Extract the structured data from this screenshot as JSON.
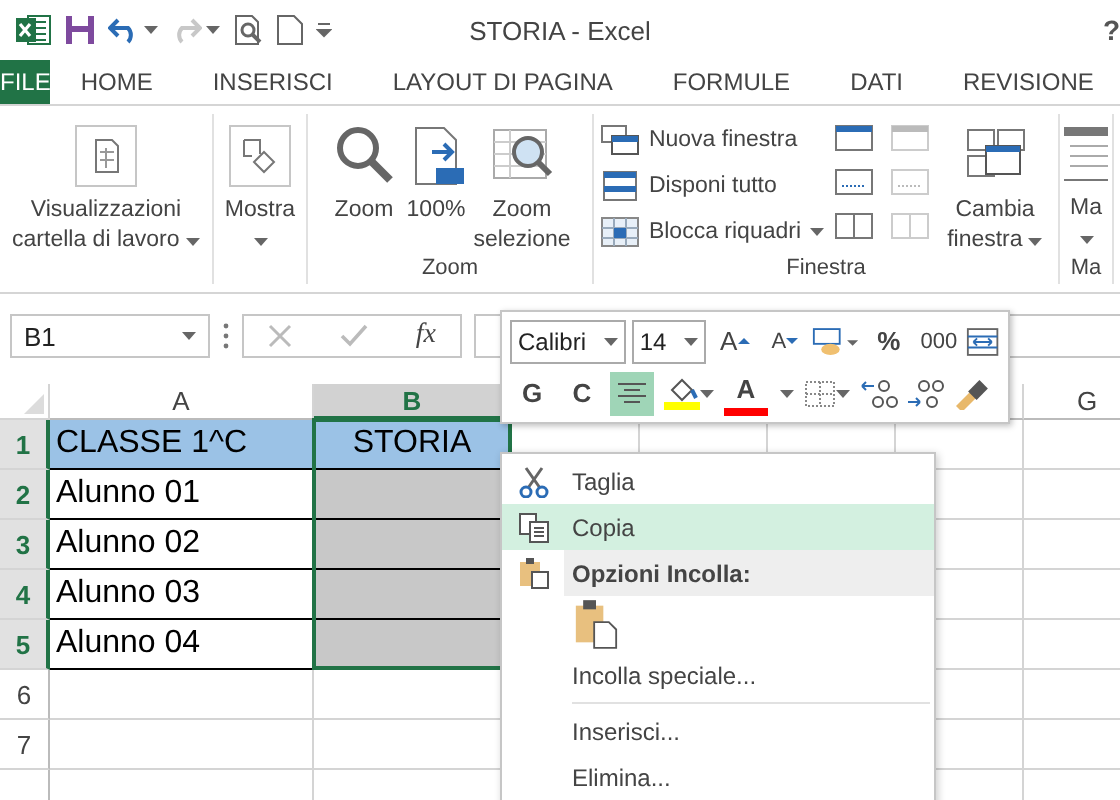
{
  "quick_access": [
    {
      "kind": "undo",
      "disabled": false
    },
    {
      "kind": "redo",
      "disabled": true
    }
  ],
  "window": {
    "title": "STORIA - Excel",
    "help": "?"
  },
  "tabs": [
    {
      "label": "FILE",
      "kind": "file",
      "selected": false
    },
    {
      "label": "HOME",
      "kind": "tab",
      "selected": false
    },
    {
      "label": "INSERISCI",
      "kind": "tab",
      "selected": false
    },
    {
      "label": "LAYOUT DI PAGINA",
      "kind": "tab",
      "selected": false
    },
    {
      "label": "FORMULE",
      "kind": "tab",
      "selected": false
    },
    {
      "label": "DATI",
      "kind": "tab",
      "selected": false
    },
    {
      "label": "REVISIONE",
      "kind": "tab",
      "selected": false
    }
  ],
  "ribbon": {
    "groups": [
      {
        "items": [
          {
            "kind": "large",
            "label": "Visualizzazioni cartella di lavoro",
            "dropdown": true
          }
        ]
      },
      {
        "items": [
          {
            "kind": "large",
            "label": "Mostra",
            "dropdown": true
          }
        ]
      },
      {
        "label": "Zoom",
        "items": [
          {
            "kind": "large",
            "label": "Zoom",
            "dropdown": false
          },
          {
            "kind": "large",
            "label": "100%",
            "dropdown": false
          },
          {
            "kind": "large",
            "label": "Zoom selezione",
            "dropdown": false
          }
        ]
      },
      {
        "label": "Finestra",
        "items": [
          {
            "kind": "stack",
            "buttons": [
              {
                "label": "Nuova finestra",
                "dropdown": false
              },
              {
                "label": "Disponi tutto",
                "dropdown": false
              },
              {
                "label": "Blocca riquadri",
                "dropdown": true
              }
            ]
          },
          {
            "kind": "icons",
            "disabled": false
          },
          {
            "kind": "icons",
            "disabled": true
          },
          {
            "kind": "large",
            "label": "Cambia finestra",
            "dropdown": true
          }
        ]
      },
      {
        "label": "Ma",
        "items": [
          {
            "kind": "large",
            "label": "Ma",
            "dropdown": true
          }
        ]
      }
    ]
  },
  "formula_bar": {
    "name_box": "B1",
    "function_button": "fx"
  },
  "mini_toolbar": {
    "font": "Calibri",
    "size": "14",
    "row_1": [
      {
        "kind": "grow",
        "label": "A"
      },
      {
        "kind": "shrink",
        "label": "A"
      },
      {
        "kind": "accounting"
      },
      {
        "kind": "text",
        "label": "%"
      },
      {
        "kind": "text",
        "label": "000"
      },
      {
        "kind": "merge"
      }
    ],
    "row_2": [
      {
        "kind": "text",
        "label": "G"
      },
      {
        "kind": "text",
        "label": "C"
      },
      {
        "kind": "center",
        "selected": true
      },
      {
        "kind": "fill",
        "color": "#ffff00"
      },
      {
        "kind": "font_color",
        "label": "A",
        "color": "#ff0000"
      },
      {
        "kind": "borders"
      },
      {
        "kind": "inc_decimal"
      },
      {
        "kind": "dec_decimal"
      },
      {
        "kind": "painter"
      }
    ]
  },
  "sheet": {
    "columns": [
      {
        "label": "A",
        "selected": false
      },
      {
        "label": "B",
        "selected": true
      },
      {
        "label": "G",
        "selected": false
      }
    ],
    "rows": [
      {
        "header": "1",
        "selected": true,
        "cells": [
          {
            "text": "CLASSE 1^C",
            "color": "#9bc2e6",
            "centered": false
          },
          {
            "text": "STORIA",
            "color": "#9bc2e6",
            "centered": true
          }
        ]
      },
      {
        "header": "2",
        "selected": true,
        "cells": [
          {
            "text": "Alunno 01",
            "centered": false
          },
          {
            "color": "#c8c8c8"
          }
        ]
      },
      {
        "header": "3",
        "selected": true,
        "cells": [
          {
            "text": "Alunno 02",
            "centered": false
          },
          {
            "color": "#c8c8c8"
          }
        ]
      },
      {
        "header": "4",
        "selected": true,
        "cells": [
          {
            "text": "Alunno 03",
            "centered": false
          },
          {
            "color": "#c8c8c8"
          }
        ]
      },
      {
        "header": "5",
        "selected": true,
        "cells": [
          {
            "text": "Alunno 04",
            "centered": false
          },
          {
            "color": "#c8c8c8"
          }
        ]
      },
      {
        "header": "6",
        "selected": false,
        "cells": []
      },
      {
        "header": "7",
        "selected": false,
        "cells": []
      }
    ]
  },
  "context_menu": [
    {
      "kind": "cut",
      "label": "Taglia",
      "selected": false
    },
    {
      "kind": "copy",
      "label": "Copia",
      "selected": true
    },
    {
      "kind": "heading",
      "label": "Opzioni Incolla:"
    },
    {
      "kind": "paste"
    },
    {
      "kind": "item",
      "label": "Incolla speciale...",
      "selected": false
    },
    {
      "kind": "separator"
    },
    {
      "kind": "item",
      "label": "Inserisci...",
      "selected": false
    },
    {
      "kind": "item",
      "label": "Elimina...",
      "selected": false
    }
  ]
}
